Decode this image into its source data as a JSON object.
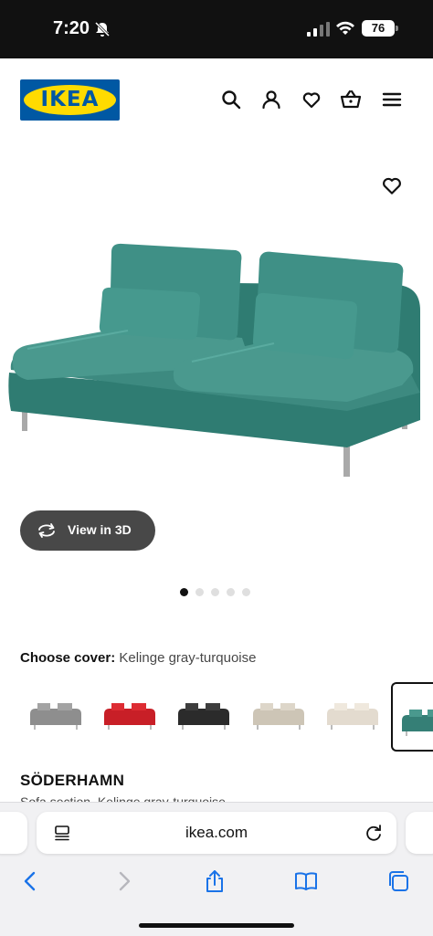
{
  "status_bar": {
    "time": "7:20",
    "battery": "76"
  },
  "header": {
    "logo_text": "IKEA",
    "icons": [
      "search-icon",
      "account-icon",
      "favorites-icon",
      "basket-icon",
      "menu-icon"
    ]
  },
  "product_image": {
    "view3d_label": "View in 3D",
    "carousel_dots": 5,
    "active_dot": 0
  },
  "cover": {
    "label": "Choose cover:",
    "value": "Kelinge gray-turquoise",
    "swatches": [
      {
        "name": "swatch-gray",
        "color": "#9a9a9a"
      },
      {
        "name": "swatch-red",
        "color": "#d2222a"
      },
      {
        "name": "swatch-black",
        "color": "#343434"
      },
      {
        "name": "swatch-beige",
        "color": "#d8d1c3"
      },
      {
        "name": "swatch-off-white",
        "color": "#ece4d8"
      },
      {
        "name": "swatch-gray-turquoise",
        "color": "#3f8f86"
      }
    ]
  },
  "product": {
    "name": "SÖDERHAMN",
    "description": "Sofa section, Kelinge gray-turquoise"
  },
  "browser": {
    "url": "ikea.com",
    "toolbar_icons": [
      "back-icon",
      "forward-icon",
      "share-icon",
      "bookmarks-icon",
      "tabs-icon"
    ]
  },
  "colors": {
    "ikea_blue": "#0058a3",
    "ikea_yellow": "#ffdb00",
    "sofa_teal": "#3d8a80"
  }
}
